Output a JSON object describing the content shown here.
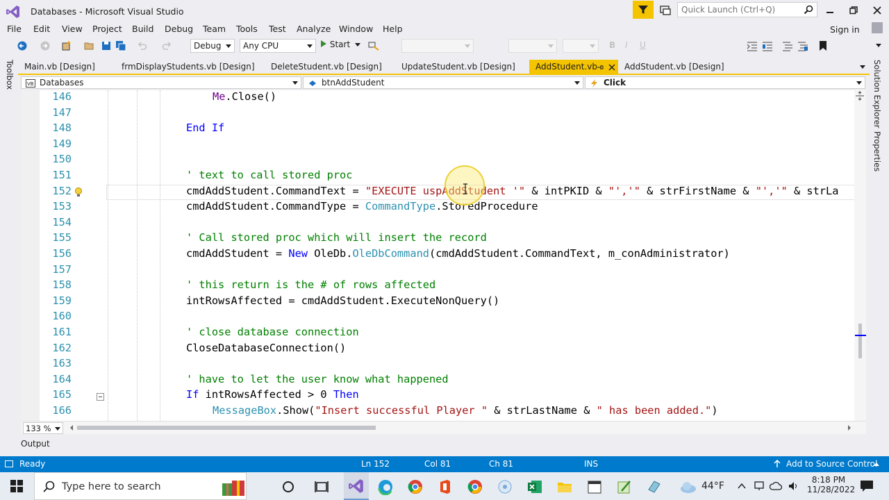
{
  "window": {
    "title": "Databases - Microsoft Visual Studio",
    "quick_launch_placeholder": "Quick Launch (Ctrl+Q)"
  },
  "menu": [
    "File",
    "Edit",
    "View",
    "Project",
    "Build",
    "Debug",
    "Team",
    "Tools",
    "Test",
    "Analyze",
    "Window",
    "Help"
  ],
  "account": {
    "sign_in": "Sign in"
  },
  "toolbar": {
    "config": "Debug",
    "platform": "Any CPU",
    "start": "Start"
  },
  "side_panels": {
    "left": "Toolbox",
    "right_top": "Solution Explorer",
    "right_bottom": "Properties"
  },
  "tabs": [
    {
      "label": "Main.vb [Design]",
      "active": false
    },
    {
      "label": "frmDisplayStudents.vb [Design]",
      "active": false
    },
    {
      "label": "DeleteStudent.vb [Design]",
      "active": false
    },
    {
      "label": "UpdateStudent.vb [Design]",
      "active": false
    },
    {
      "label": "AddStudent.vb",
      "active": true
    },
    {
      "label": "AddStudent.vb [Design]",
      "active": false
    }
  ],
  "navbar": {
    "project": "Databases",
    "object": "btnAddStudent",
    "event": "Click"
  },
  "code_lines": [
    {
      "n": "146",
      "text": "Me.Close()"
    },
    {
      "n": "147",
      "text": ""
    },
    {
      "n": "148",
      "text": "End If"
    },
    {
      "n": "149",
      "text": ""
    },
    {
      "n": "150",
      "text": ""
    },
    {
      "n": "151",
      "text": "' text to call stored proc"
    },
    {
      "n": "152",
      "text": "cmdAddStudent.CommandText = \"EXECUTE uspAddStudent '\" & intPKID & \"','\" & strFirstName & \"','\" & strLa"
    },
    {
      "n": "153",
      "text": "cmdAddStudent.CommandType = CommandType.StoredProcedure"
    },
    {
      "n": "154",
      "text": ""
    },
    {
      "n": "155",
      "text": "' Call stored proc which will insert the record"
    },
    {
      "n": "156",
      "text": "cmdAddStudent = New OleDb.OleDbCommand(cmdAddStudent.CommandText, m_conAdministrator)"
    },
    {
      "n": "157",
      "text": ""
    },
    {
      "n": "158",
      "text": "' this return is the # of rows affected"
    },
    {
      "n": "159",
      "text": "intRowsAffected = cmdAddStudent.ExecuteNonQuery()"
    },
    {
      "n": "160",
      "text": ""
    },
    {
      "n": "161",
      "text": "' close database connection"
    },
    {
      "n": "162",
      "text": "CloseDatabaseConnection()"
    },
    {
      "n": "163",
      "text": ""
    },
    {
      "n": "164",
      "text": "' have to let the user know what happened"
    },
    {
      "n": "165",
      "text": "If intRowsAffected > 0 Then"
    },
    {
      "n": "166",
      "text": "MessageBox.Show(\"Insert successful Player \" & strLastName & \" has been added.\")"
    }
  ],
  "editor": {
    "zoom": "133 %"
  },
  "output_tab": "Output",
  "status": {
    "state": "Ready",
    "line": "Ln 152",
    "col": "Col 81",
    "ch": "Ch 81",
    "mode": "INS",
    "source_control": "Add to Source Control"
  },
  "taskbar": {
    "search_placeholder": "Type here to search",
    "weather": "44°F",
    "time": "8:18 PM",
    "date": "11/28/2022"
  },
  "colors": {
    "accent_yellow": "#f5c400",
    "status_blue": "#007acc",
    "keyword": "#0000ff",
    "comment": "#008000",
    "string": "#a31515",
    "type": "#2b91af"
  }
}
